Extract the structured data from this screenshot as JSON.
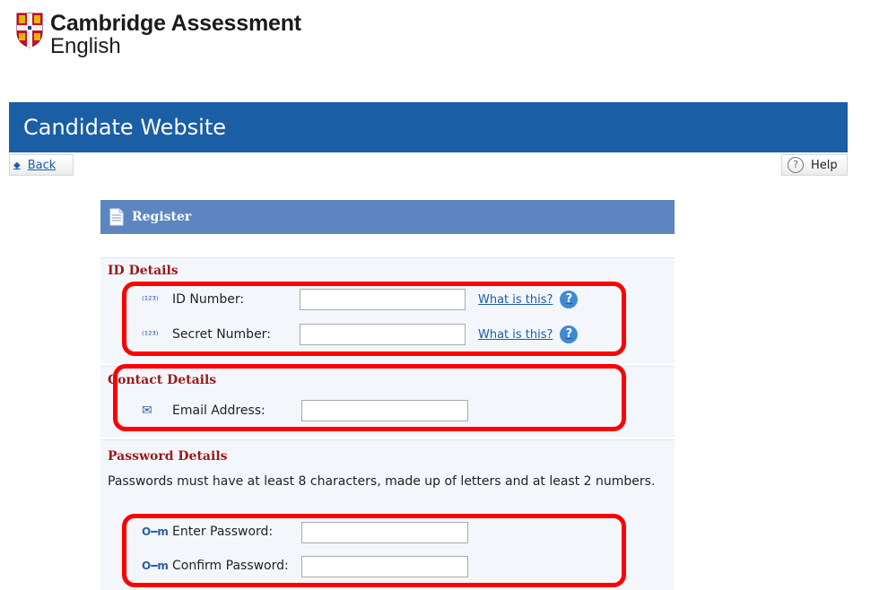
{
  "brand": {
    "org": "Cambridge Assessment",
    "sub": "English"
  },
  "banner": {
    "title": "Candidate Website"
  },
  "toolbar": {
    "back_label": "Back",
    "help_label": "Help"
  },
  "register": {
    "title": "Register",
    "id_details": {
      "title": "ID Details",
      "id_number_label": "ID Number:",
      "id_number_value": "",
      "secret_number_label": "Secret Number:",
      "secret_number_value": "",
      "what_is_this": "What is this?"
    },
    "contact_details": {
      "title": "Contact Details",
      "email_label": "Email Address:",
      "email_value": ""
    },
    "password_details": {
      "title": "Password Details",
      "description": "Passwords must have at least 8 characters, made up of letters and at least 2 numbers.",
      "enter_label": "Enter Password:",
      "confirm_label": "Confirm Password:"
    }
  },
  "icons": {
    "number": "123-icon",
    "email": "envelope-icon",
    "password": "key-icon"
  },
  "colors": {
    "banner": "#1a5ea6",
    "panel_header": "#5d86c1",
    "section_title": "#9a1a1a",
    "highlight": "#ff0000"
  }
}
